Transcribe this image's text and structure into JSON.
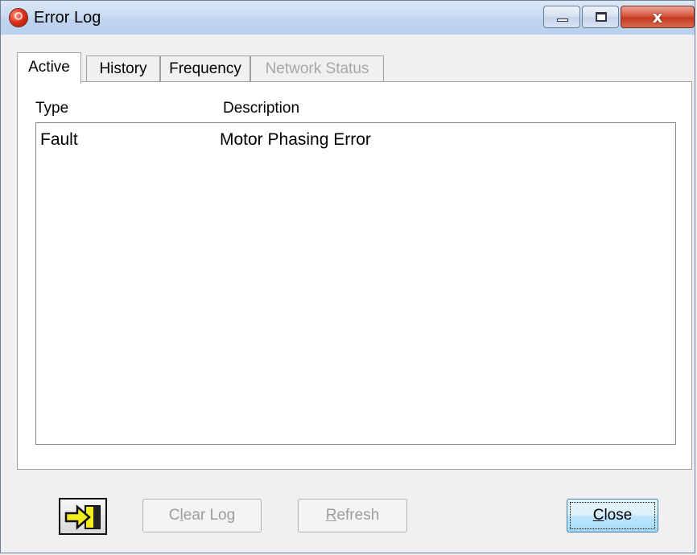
{
  "window": {
    "title": "Error Log",
    "close_glyph": "x"
  },
  "tabs": [
    {
      "label": "Active",
      "state": "selected"
    },
    {
      "label": "History",
      "state": "normal"
    },
    {
      "label": "Frequency",
      "state": "normal"
    },
    {
      "label": "Network Status",
      "state": "disabled"
    }
  ],
  "table": {
    "columns": [
      "Type",
      "Description"
    ],
    "rows": [
      {
        "type": "Fault",
        "description": "Motor Phasing Error"
      }
    ]
  },
  "buttons": {
    "clear_log": {
      "label_prefix": "C",
      "label_mnemonic": "l",
      "label_suffix": "ear Log",
      "enabled": false
    },
    "refresh": {
      "label_prefix": "",
      "label_mnemonic": "R",
      "label_suffix": "efresh",
      "enabled": false
    },
    "close": {
      "label_prefix": "",
      "label_mnemonic": "C",
      "label_suffix": "lose",
      "enabled": true,
      "default": true
    }
  },
  "icons": {
    "app": "error-log-app-icon",
    "export": "export-arrow-icon"
  },
  "colors": {
    "titlebar": "#c9dcf2",
    "close_button": "#c43a22",
    "export_arrow": "#f2ee1c",
    "disabled_text": "#9c9c9c"
  }
}
